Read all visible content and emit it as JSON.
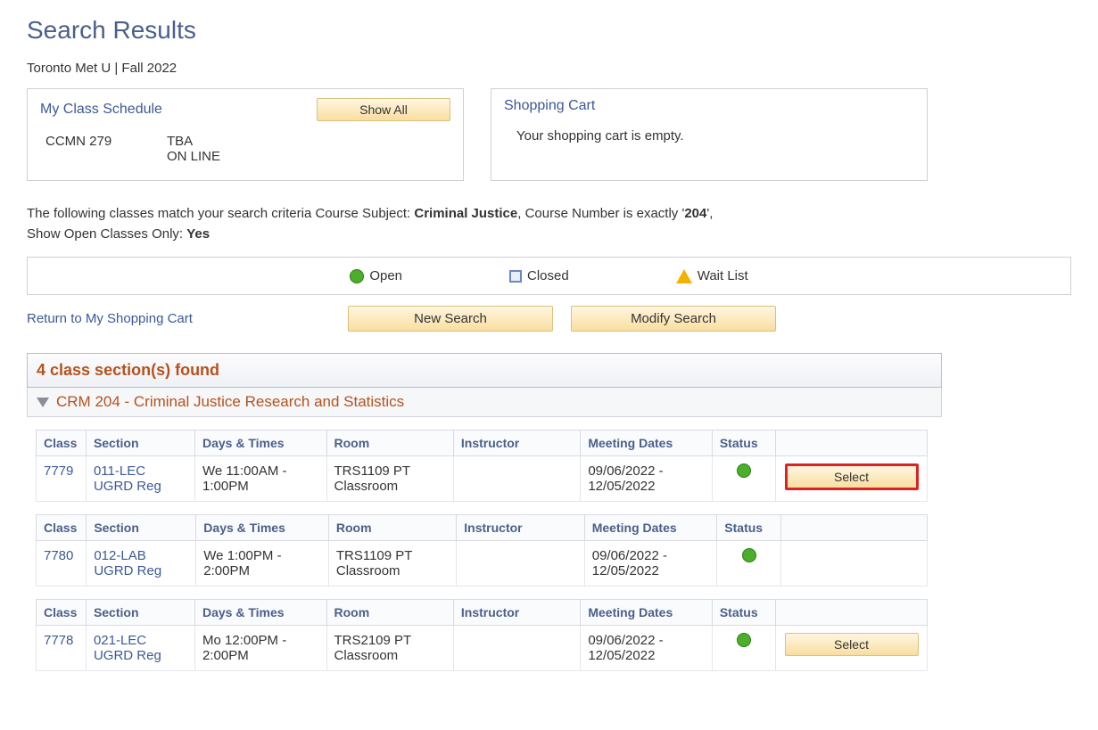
{
  "page": {
    "title": "Search Results",
    "context": "Toronto Met U | Fall 2022"
  },
  "schedule_panel": {
    "title": "My Class Schedule",
    "show_all_label": "Show All",
    "rows": [
      {
        "course": "CCMN 279",
        "time": "TBA",
        "mode": "ON LINE"
      }
    ]
  },
  "cart_panel": {
    "title": "Shopping Cart",
    "empty_msg": "Your shopping cart is empty."
  },
  "criteria": {
    "prefix": "The following classes match your search criteria Course Subject: ",
    "subject": "Criminal Justice",
    "mid1": ",  Course Number is exactly '",
    "number": "204",
    "mid2": "',  Show Open Classes Only: ",
    "open_only": "Yes"
  },
  "legend": {
    "open": "Open",
    "closed": "Closed",
    "waitlist": "Wait List"
  },
  "links": {
    "return_cart": "Return to My Shopping Cart"
  },
  "buttons": {
    "new_search": "New Search",
    "modify_search": "Modify Search",
    "select": "Select"
  },
  "results": {
    "found_text": "4 class section(s) found",
    "course_title": "CRM 204 - Criminal Justice Research and Statistics",
    "headers": {
      "class": "Class",
      "section": "Section",
      "days": "Days & Times",
      "room": "Room",
      "instructor": "Instructor",
      "dates": "Meeting Dates",
      "status": "Status"
    },
    "sections": [
      {
        "class_nbr": "7779",
        "section": "011-LEC UGRD Reg",
        "days": "We 11:00AM - 1:00PM",
        "room": "TRS1109 PT Classroom",
        "instructor": "",
        "dates": "09/06/2022 - 12/05/2022",
        "status": "open",
        "select": true,
        "highlight": true
      },
      {
        "class_nbr": "7780",
        "section": "012-LAB UGRD Reg",
        "days": "We 1:00PM - 2:00PM",
        "room": "TRS1109 PT Classroom",
        "instructor": "",
        "dates": "09/06/2022 - 12/05/2022",
        "status": "open",
        "select": false,
        "highlight": false
      },
      {
        "class_nbr": "7778",
        "section": "021-LEC UGRD Reg",
        "days": "Mo 12:00PM - 2:00PM",
        "room": "TRS2109 PT Classroom",
        "instructor": "",
        "dates": "09/06/2022 - 12/05/2022",
        "status": "open",
        "select": true,
        "highlight": false
      }
    ]
  }
}
